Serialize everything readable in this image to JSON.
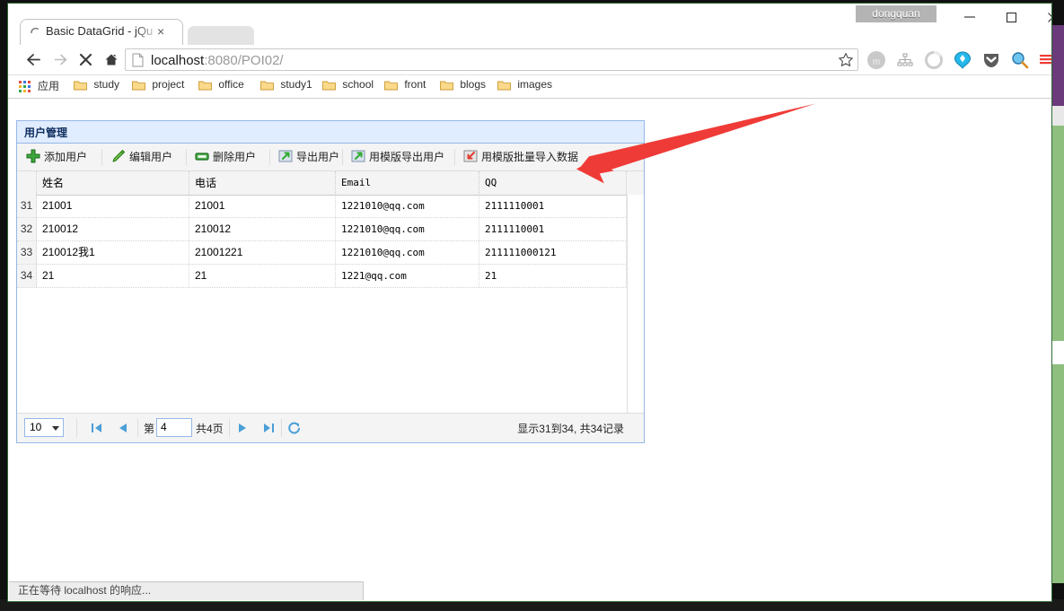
{
  "window": {
    "user_badge": "dongquan",
    "minimize_icon": "minimize-icon",
    "maximize_icon": "maximize-icon",
    "close_icon": "close-icon"
  },
  "tab": {
    "title": "Basic DataGrid - jQuery",
    "close_label": "×",
    "loading_icon": "loading-spinner-icon"
  },
  "nav": {
    "back_icon": "back-arrow-icon",
    "forward_icon": "forward-arrow-icon",
    "stop_icon": "stop-x-icon",
    "home_icon": "home-icon",
    "url_host": "localhost",
    "url_rest": ":8080/POI02/",
    "star_icon": "bookmark-star-icon",
    "menu_icon": "browser-menu-icon",
    "extensions": [
      "extension-m-icon",
      "extension-sitemap-icon",
      "extension-circle-icon",
      "extension-diamond-icon",
      "extension-pocket-icon",
      "extension-magnifier-icon"
    ]
  },
  "bookmarks": {
    "apps_label": "应用",
    "items": [
      {
        "label": "study"
      },
      {
        "label": "project"
      },
      {
        "label": "office"
      },
      {
        "label": "study1"
      },
      {
        "label": "school"
      },
      {
        "label": "front"
      },
      {
        "label": "blogs"
      },
      {
        "label": "images"
      }
    ]
  },
  "panel": {
    "title": "用户管理",
    "toolbar": [
      {
        "label": "添加用户",
        "icon": "add-user-icon"
      },
      {
        "label": "编辑用户",
        "icon": "edit-user-icon"
      },
      {
        "label": "删除用户",
        "icon": "remove-user-icon"
      },
      {
        "label": "导出用户",
        "icon": "export-user-icon"
      },
      {
        "label": "用模版导出用户",
        "icon": "export-template-icon"
      },
      {
        "label": "用模版批量导入数据",
        "icon": "import-template-icon"
      }
    ]
  },
  "grid": {
    "columns": [
      "姓名",
      "电话",
      "Email",
      "QQ"
    ],
    "rows": [
      {
        "num": "31",
        "name": "21001",
        "phone": "21001",
        "email": "1221010@qq.com",
        "qq": "2111110001"
      },
      {
        "num": "32",
        "name": "210012",
        "phone": "210012",
        "email": "1221010@qq.com",
        "qq": "2111110001"
      },
      {
        "num": "33",
        "name": "210012我1",
        "phone": "21001221",
        "email": "1221010@qq.com",
        "qq": "211111000121"
      },
      {
        "num": "34",
        "name": "21",
        "phone": "21",
        "email": "1221@qq.com",
        "qq": "21"
      }
    ]
  },
  "pager": {
    "page_size": "10",
    "first_icon": "first-page-icon",
    "prev_icon": "prev-page-icon",
    "page_prefix": "第",
    "page_number": "4",
    "page_suffix": "共4页",
    "next_icon": "next-page-icon",
    "last_icon": "last-page-icon",
    "refresh_icon": "refresh-icon",
    "info": "显示31到34, 共34记录"
  },
  "annotation": {
    "arrow_color": "#ef3b37",
    "arrow_name": "red-pointer-arrow"
  },
  "status": {
    "text": "正在等待 localhost 的响应..."
  }
}
